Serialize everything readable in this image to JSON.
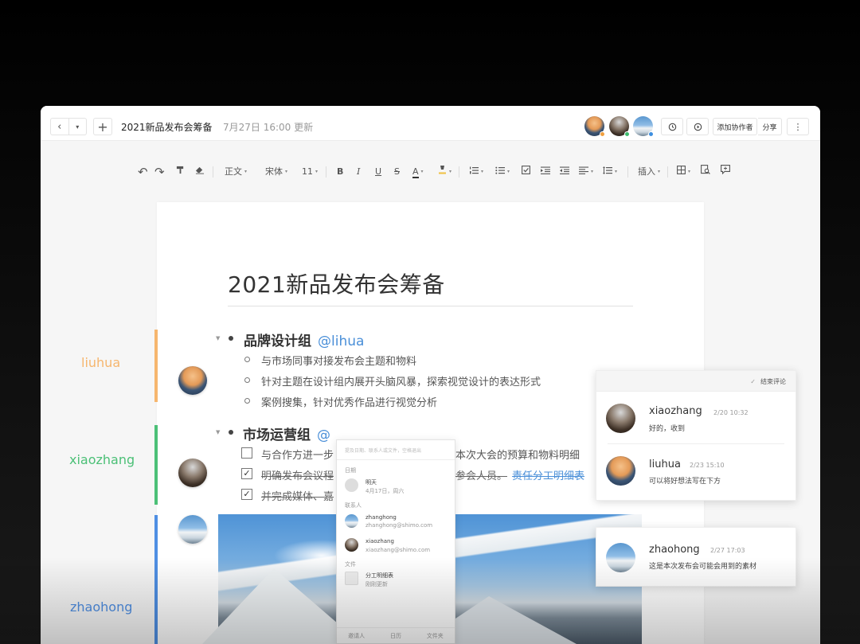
{
  "titlebar": {
    "back_glyph": "‹",
    "menu_glyph": "▾",
    "new_glyph": "+",
    "doc_title": "2021新品发布会筹备",
    "updated": "7月27日 16:00 更新",
    "history_icon": "history-icon",
    "present_icon": "play-icon",
    "add_collaborator": "添加协作者",
    "share": "分享",
    "more_glyph": "⋮",
    "presence_colors": [
      "#f0a040",
      "#3dba6c",
      "#3d8fe0"
    ]
  },
  "toolbar": {
    "undo": "↶",
    "redo": "↷",
    "format_painter": "format-painter-icon",
    "clear_format": "eraser-icon",
    "style": "正文",
    "font": "宋体",
    "size": "11",
    "bold": "B",
    "italic": "I",
    "underline": "U",
    "strike": "S",
    "font_color": "A",
    "highlight": "highlight-icon",
    "ordered_list": "ordered-list-icon",
    "bullet_list": "bullet-list-icon",
    "task_list": "task-list-icon",
    "indent": "indent-icon",
    "outdent": "outdent-icon",
    "align": "align-icon",
    "line_height": "line-height-icon",
    "insert": "插入",
    "table": "table-icon",
    "find": "find-icon",
    "comment": "comment-icon"
  },
  "document": {
    "title": "2021新品发布会筹备",
    "section1": {
      "heading": "品牌设计组",
      "mention": "@lihua",
      "items": [
        "与市场同事对接发布会主题和物料",
        "针对主题在设计组内展开头脑风暴，探索视觉设计的表达形式",
        "案例搜集，针对优秀作品进行视觉分析"
      ]
    },
    "section2": {
      "heading": "市场运营组",
      "mention": "@",
      "tasks": [
        {
          "left": "与合作方进一步",
          "right": "本次大会的预算和物料明细",
          "checked": false
        },
        {
          "left": "明确发布会议程",
          "right": "参会人员。",
          "link": "责任分工明细表",
          "checked": true
        },
        {
          "left": "并完成媒体、嘉",
          "checked": true
        }
      ]
    }
  },
  "side": {
    "users": [
      {
        "name": "liuhua",
        "color": "#f6b66e"
      },
      {
        "name": "xiaozhang",
        "color": "#4cc077"
      },
      {
        "name": "zhaohong",
        "color": "#4f8fe3"
      }
    ]
  },
  "mention_popup": {
    "hint": "提及日期、联系人或文件，空格退出",
    "date_label": "日期",
    "date_name": "明天",
    "date_sub": "4月17日，周六",
    "contacts_label": "联系人",
    "contacts": [
      {
        "name": "zhanghong",
        "email": "zhanghong@shimo.com"
      },
      {
        "name": "xiaozhang",
        "email": "xiaozhang@shimo.com"
      }
    ],
    "files_label": "文件",
    "file_name": "分工明细表",
    "file_sub": "刚刚更新",
    "tabs": [
      "邀请人",
      "日历",
      "文件夹"
    ]
  },
  "comments": {
    "resolve": "结束评论",
    "items": [
      {
        "name": "xiaozhang",
        "date": "2/20 10:32",
        "text": "好的，收到"
      },
      {
        "name": "liuhua",
        "date": "2/23 15:10",
        "text": "可以将好想法写在下方"
      }
    ],
    "single": {
      "name": "zhaohong",
      "date": "2/27 17:03",
      "text": "这是本次发布会可能会用到的素材"
    }
  }
}
